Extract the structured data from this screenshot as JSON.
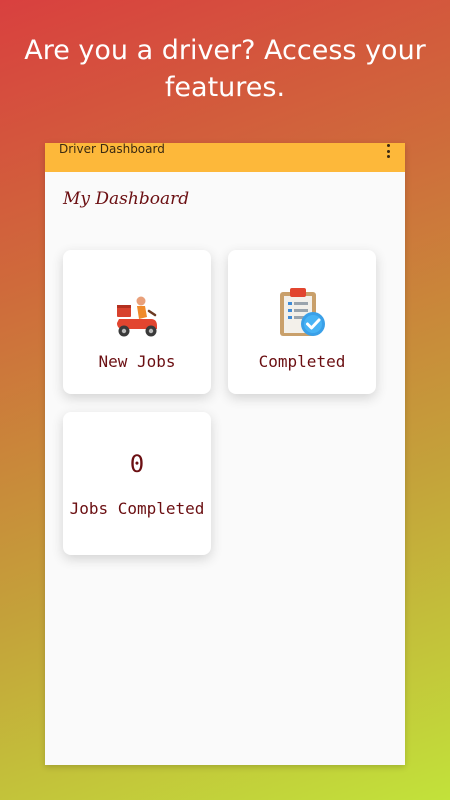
{
  "promo": {
    "line1": "Are you a driver? Access your",
    "line2": "features."
  },
  "appbar": {
    "title": "Driver Dashboard",
    "menu_icon": "more-vert-icon",
    "color": "#fdb83a"
  },
  "dashboard": {
    "title": "My Dashboard",
    "cards": [
      {
        "label": "New Jobs",
        "icon": "delivery-scooter-icon"
      },
      {
        "label": "Completed",
        "icon": "clipboard-check-icon"
      },
      {
        "count": "0",
        "label": "Jobs Completed"
      }
    ]
  },
  "colors": {
    "text_accent": "#6b0f12",
    "background_gradient_start": "#d9403f",
    "background_gradient_end": "#c2e23a"
  }
}
